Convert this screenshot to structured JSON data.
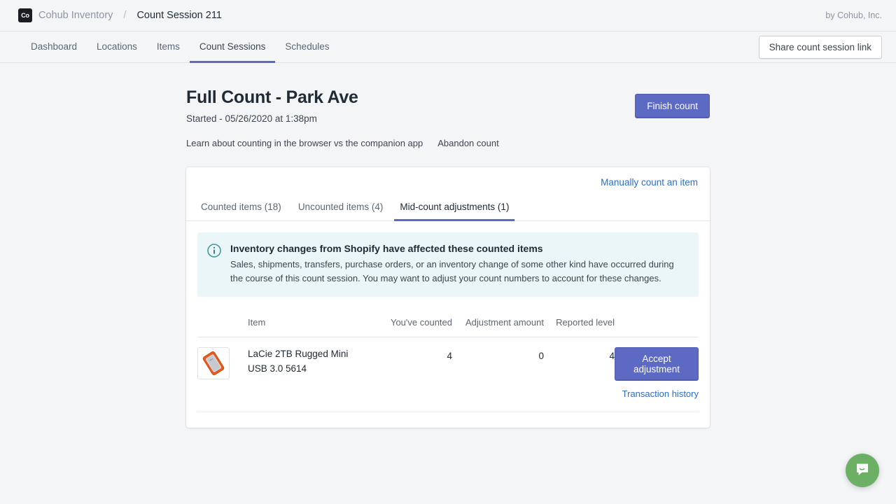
{
  "topbar": {
    "logo_text": "Co",
    "brand_name": "Cohub Inventory",
    "separator": "/",
    "page_ref": "Count Session 211",
    "byline": "by Cohub, Inc."
  },
  "nav": {
    "items": [
      {
        "label": "Dashboard",
        "active": false
      },
      {
        "label": "Locations",
        "active": false
      },
      {
        "label": "Items",
        "active": false
      },
      {
        "label": "Count Sessions",
        "active": true
      },
      {
        "label": "Schedules",
        "active": false
      }
    ],
    "share_button": "Share count session link"
  },
  "page": {
    "title": "Full Count - Park Ave",
    "subtitle": "Started - 05/26/2020 at 1:38pm",
    "learn_link": "Learn about counting in the browser vs the companion app",
    "abandon_link": "Abandon count",
    "finish_button": "Finish count"
  },
  "card": {
    "manual_link": "Manually count an item",
    "tabs": [
      {
        "label": "Counted items (18)",
        "active": false
      },
      {
        "label": "Uncounted items (4)",
        "active": false
      },
      {
        "label": "Mid-count adjustments (1)",
        "active": true
      }
    ],
    "banner": {
      "icon": "info-circle-icon",
      "title": "Inventory changes from Shopify have affected these counted items",
      "body": "Sales, shipments, transfers, purchase orders, or an inventory change of some other kind have occurred during the course of this count session. You may want to adjust your count numbers to account for these changes."
    },
    "table": {
      "headers": {
        "thumb": "",
        "item": "Item",
        "counted": "You've counted",
        "adjustment": "Adjustment amount",
        "reported": "Reported level",
        "actions": ""
      },
      "rows": [
        {
          "thumbnail": "orange-hard-drive-thumbnail",
          "name_line1": "LaCie 2TB Rugged Mini",
          "name_line2": "USB 3.0 5614",
          "counted": "4",
          "adjustment": "0",
          "reported": "4",
          "accept_button": "Accept adjustment",
          "history_link": "Transaction history"
        }
      ]
    }
  },
  "chat": {
    "icon": "chat-bubble-icon"
  },
  "colors": {
    "accent_indigo": "#5c6ac4",
    "link_blue": "#2c6ecb",
    "banner_bg": "#eaf6f7",
    "banner_icon": "#3f7f86",
    "chat_green": "#6cb065",
    "page_bg": "#f4f5f7"
  }
}
